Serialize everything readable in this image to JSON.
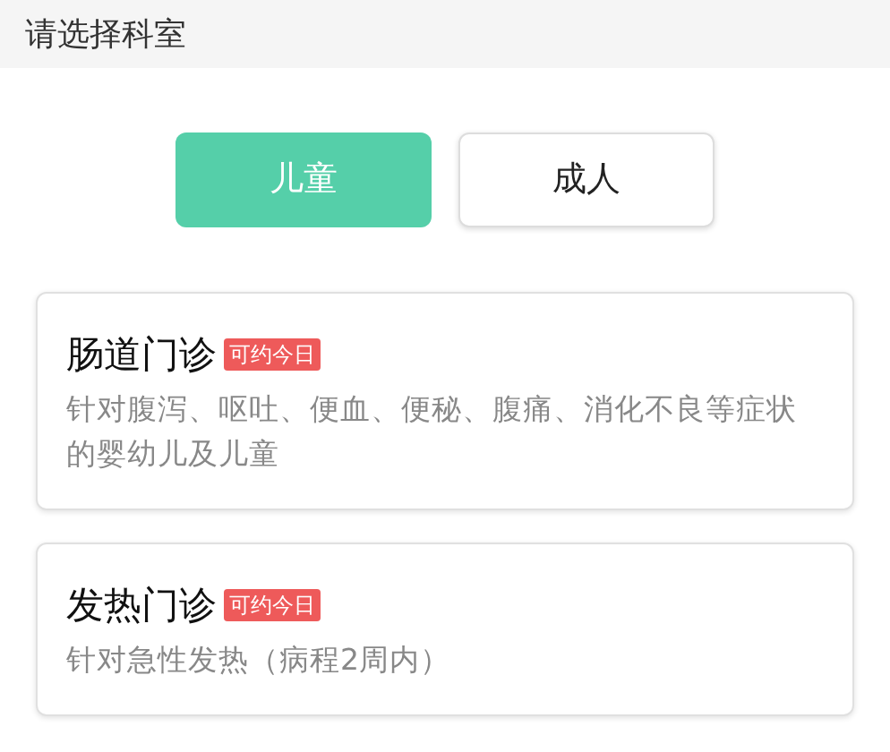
{
  "header": {
    "title": "请选择科室"
  },
  "tabs": [
    {
      "label": "儿童",
      "selected": true
    },
    {
      "label": "成人",
      "selected": false
    }
  ],
  "departments": [
    {
      "name": "肠道门诊",
      "badge": "可约今日",
      "description": "针对腹泻、呕吐、便血、便秘、腹痛、消化不良等症状的婴幼儿及儿童"
    },
    {
      "name": "发热门诊",
      "badge": "可约今日",
      "description": "针对急性发热（病程2周内）"
    }
  ]
}
